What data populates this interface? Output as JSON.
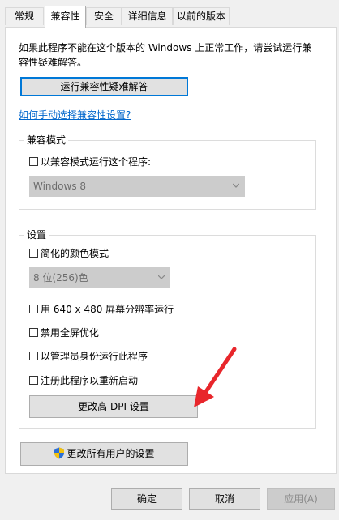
{
  "tabs": [
    {
      "label": "常规",
      "active": false
    },
    {
      "label": "兼容性",
      "active": true
    },
    {
      "label": "安全",
      "active": false
    },
    {
      "label": "详细信息",
      "active": false
    },
    {
      "label": "以前的版本",
      "active": false
    }
  ],
  "intro": {
    "line1": "如果此程序不能在这个版本的 Windows 上正常工作，请尝试运行兼",
    "line2": "容性疑难解答。"
  },
  "troubleshooter_button": "运行兼容性疑难解答",
  "manual_link": "如何手动选择兼容性设置?",
  "compat_mode": {
    "title": "兼容模式",
    "checkbox_label": "以兼容模式运行这个程序:",
    "checked": false,
    "os_select_value": "Windows 8"
  },
  "settings": {
    "title": "设置",
    "reduced_color_label": "简化的颜色模式",
    "color_select_value": "8 位(256)色",
    "res_640_label": "用 640 x 480 屏幕分辨率运行",
    "disable_fullscreen_label": "禁用全屏优化",
    "run_as_admin_label": "以管理员身份运行此程序",
    "register_restart_label": "注册此程序以重新启动",
    "dpi_button": "更改高 DPI 设置"
  },
  "all_users_button": "更改所有用户的设置",
  "footer": {
    "ok": "确定",
    "cancel": "取消",
    "apply": "应用(A)"
  },
  "icons": {
    "shield": "shield-icon",
    "chevron": "chevron-down-icon",
    "annotation": "red-arrow-annotation"
  },
  "colors": {
    "focus_border": "#0078d7",
    "link": "#0066cc",
    "annotation_arrow": "#e8262b",
    "disabled_text": "#6d6d6d"
  }
}
